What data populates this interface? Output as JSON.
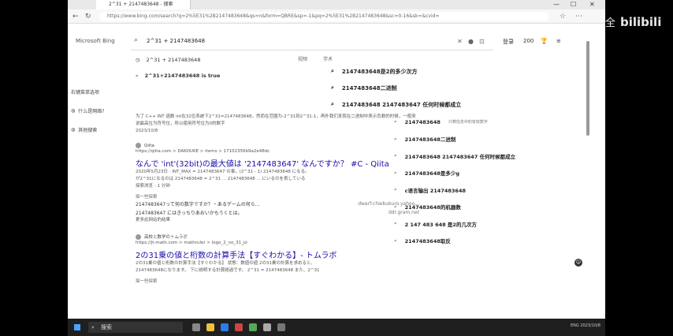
{
  "browser": {
    "tab_title": "2^31 + 2147483648 - 搜索",
    "url": "https://www.bing.com/search?q=2%5E31%2B2147483648&qs=n&form=QBRE&sp=-1&pq=2%5E31%2B2147483648&sc=0-16&sk=&cvid=",
    "minimize": "—",
    "maximize": "☐",
    "close": "✕"
  },
  "bing": {
    "logo_text": "Microsoft Bing",
    "search_value": "2^31 + 2147483648",
    "login": "登录",
    "points": "200"
  },
  "suggestions_left": [
    {
      "text": "2^31 + 2147483648"
    },
    {
      "text": "2^31+2147483648 is true"
    }
  ],
  "tabs": [
    "视频",
    "学术"
  ],
  "suggestions_right": [
    "2147483648是2的多少次方",
    "2147483648二进制",
    "2147483648 2147483647 任何时候都成立"
  ],
  "left_nav": [
    "右键菜单选项",
    "什么是网络?",
    "其他搜索"
  ],
  "result_top_snippet": "为了 C++ INT 函数 int在32位系统下2^31=2147483648，然而在范围为-2^31到2^31-1，再外我们发现在二进制中表示负数的时候，一般来说最高位为符号位，所以使用符号位为0的数字",
  "result_top_meta": "2023/10/8",
  "qiita": {
    "site": "Qiita",
    "url": "https://qiita.com > DAKOUKE > items > 17102356b9a2e48dc",
    "title": "なんで 'int'(32bit)の最大値は '2147483647' なんですか？ #C - Qiita",
    "snippet1": "2020年5月23日 · INT_MAX = 2147483647 の事，(2^31 - 1) 2147483648 になる。",
    "snippet2": "が2^31になるのは 2147483648 = 2^31 ... 2147483648 ... にいるのを表している",
    "more": "探索浏览 - 1 分钟",
    "sub_header": "探一些探索",
    "sub_rows": [
      {
        "text": "2147483647って何の数字ですか？・あるゲームの何ら...",
        "side": "dwarf-chiebukuro.yahoo..."
      },
      {
        "text": "2147483647 にはきっちりあおいかもうくとは。",
        "side": "ddr.gram.net"
      }
    ],
    "sub_more": "更多此网站的结果"
  },
  "tomura": {
    "site": "高校と数学のトムラボ",
    "url": "https://jt-math.com > mathruler > logo_2_no_31_jo",
    "title": "2の31乗の値と桁数の計算手法【すぐわかる】- トムラボ",
    "snippet1": "2の31乗の値と桁数の計算手法【すぐわかる】 状態：数値の値 2の31乗の計算を求めると、",
    "snippet2": "2147483648になります。 下に説明する計算経過です。 2^31 = 2147483648 また、2^31",
    "sub_header": "探一些探索"
  },
  "related": [
    {
      "text": "2147483648",
      "note": "计算信息中的有效数字"
    },
    {
      "text": "2147483648二进制",
      "note": ""
    },
    {
      "text": "2147483648 2147483647 任何时候都成立",
      "note": ""
    },
    {
      "text": "2147483648是多少g",
      "note": ""
    },
    {
      "text": "c语言输出 2147483648",
      "note": ""
    },
    {
      "text": "2147483648的机器数",
      "note": ""
    },
    {
      "text": "2 147 483 648 是2的几次方",
      "note": ""
    },
    {
      "text": "2147483648取反",
      "note": ""
    }
  ],
  "taskbar": {
    "search_label": "搜索",
    "tray": "ENG 2023/10/8"
  },
  "watermark": {
    "a": "全",
    "b": "bilibili"
  }
}
